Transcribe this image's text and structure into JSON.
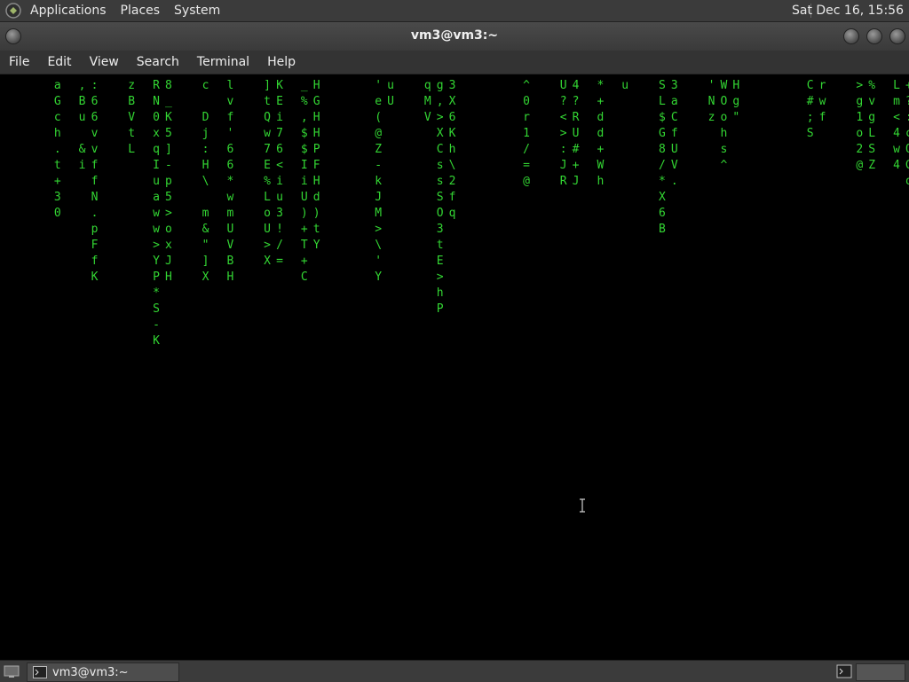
{
  "top_panel": {
    "menus": [
      "Applications",
      "Places",
      "System"
    ],
    "clock": "Sat Dec 16, 15:56"
  },
  "window": {
    "title": "vm3@vm3:~"
  },
  "menubar": [
    "File",
    "Edit",
    "View",
    "Search",
    "Terminal",
    "Help"
  ],
  "taskbar": {
    "task_label": "vm3@vm3:~"
  },
  "terminal": {
    "color": "#33d633",
    "highlight_color": "#f4f4f4",
    "columns": [
      {
        "col": 2,
        "start": 0,
        "chars": "aGch.t+30"
      },
      {
        "col": 4,
        "start": 0,
        "chars": ",Bu &i "
      },
      {
        "col": 5,
        "start": 0,
        "chars": ":66vvffN.pFfK"
      },
      {
        "col": 8,
        "start": 0,
        "chars": "zBVtL"
      },
      {
        "col": 10,
        "start": 0,
        "chars": "RN0xqIuaww>YP*S-K"
      },
      {
        "col": 11,
        "start": 0,
        "chars": "8_K5]-p5>oxJH"
      },
      {
        "col": 14,
        "start": 0,
        "chars": "c Dj:H\\ m&\"]X"
      },
      {
        "col": 16,
        "start": 0,
        "chars": "lvf'66*wmUVBH"
      },
      {
        "col": 19,
        "start": 0,
        "chars": "]tQw7E%LoU>X"
      },
      {
        "col": 20,
        "start": 0,
        "chars": "KEi76<iu3!/="
      },
      {
        "col": 22,
        "start": 0,
        "chars": "_%,$$IiU)+T+C"
      },
      {
        "col": 23,
        "start": 0,
        "chars": "HGHHPFHd)tY"
      },
      {
        "col": 28,
        "start": 0,
        "chars": "'e(@Z-kJM>\\'Y"
      },
      {
        "col": 29,
        "start": 0,
        "chars": "uU"
      },
      {
        "col": 32,
        "start": 0,
        "chars": "qMV"
      },
      {
        "col": 33,
        "start": 0,
        "chars": "g,>XCssSO3tE>hP"
      },
      {
        "col": 34,
        "start": 0,
        "chars": "3X6Kh\\2fq"
      },
      {
        "col": 40,
        "start": 0,
        "chars": "^0r1/=@"
      },
      {
        "col": 43,
        "start": 0,
        "chars": "U?<>:JR"
      },
      {
        "col": 44,
        "start": 0,
        "chars": "4?RU#+J"
      },
      {
        "col": 46,
        "start": 0,
        "chars": "*+dd+Wh "
      },
      {
        "col": 48,
        "start": 0,
        "chars": "u"
      },
      {
        "col": 51,
        "start": 0,
        "chars": "SL$G8/*X6B"
      },
      {
        "col": 52,
        "start": 0,
        "chars": "3aCfUV."
      },
      {
        "col": 55,
        "start": 0,
        "chars": "'Nz"
      },
      {
        "col": 56,
        "start": 0,
        "chars": "WOohs^"
      },
      {
        "col": 57,
        "start": 0,
        "chars": "Hg\""
      },
      {
        "col": 63,
        "start": 0,
        "chars": "C#;S"
      },
      {
        "col": 64,
        "start": 0,
        "chars": "rwf"
      },
      {
        "col": 67,
        "start": 0,
        "chars": ">g1o2@"
      },
      {
        "col": 68,
        "start": 0,
        "chars": "%vgLSZ"
      },
      {
        "col": 70,
        "start": 0,
        "chars": "Lm<4w4"
      },
      {
        "col": 71,
        "start": 0,
        "chars": "+?:cQGo"
      }
    ]
  }
}
